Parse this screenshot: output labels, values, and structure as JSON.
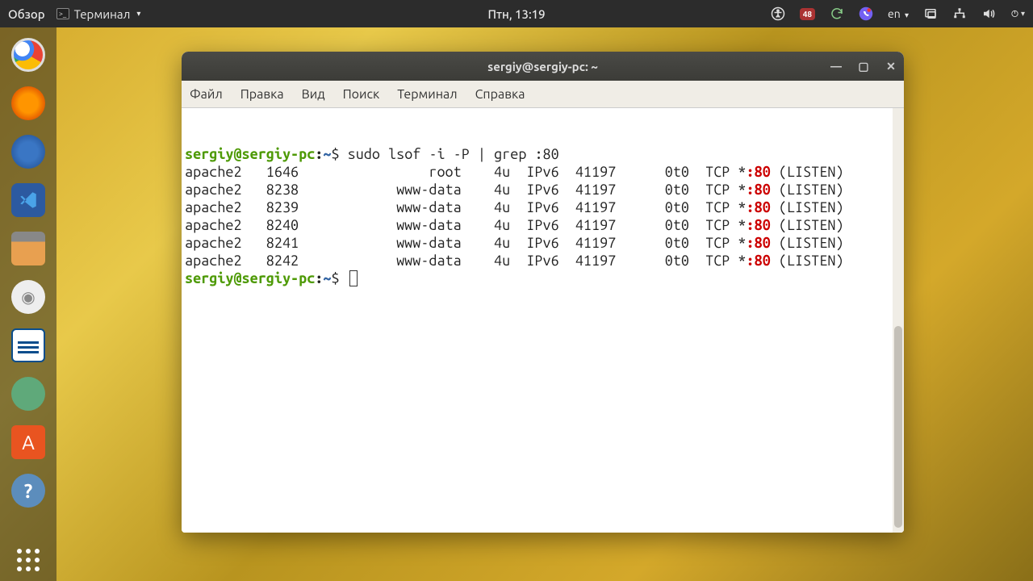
{
  "top_panel": {
    "overview": "Обзор",
    "app_menu": "Терминал",
    "clock": "Птн, 13:19",
    "tray": {
      "badge": "48",
      "lang": "en"
    }
  },
  "window": {
    "title": "sergiy@sergiy-pc: ~",
    "menu": {
      "file": "Файл",
      "edit": "Правка",
      "view": "Вид",
      "search": "Поиск",
      "terminal": "Терминал",
      "help": "Справка"
    }
  },
  "terminal": {
    "prompt_user": "sergiy@sergiy-pc",
    "prompt_path": "~",
    "command": "sudo lsof -i -P | grep :80",
    "rows": [
      {
        "proc": "apache2",
        "pid": "1646",
        "user": "root",
        "fd": "4u",
        "type": "IPv6",
        "dev": "41197",
        "sz": "0t0",
        "node": "TCP",
        "name_pre": "*",
        "port": ":80",
        "name_post": " (LISTEN)"
      },
      {
        "proc": "apache2",
        "pid": "8238",
        "user": "www-data",
        "fd": "4u",
        "type": "IPv6",
        "dev": "41197",
        "sz": "0t0",
        "node": "TCP",
        "name_pre": "*",
        "port": ":80",
        "name_post": " (LISTEN)"
      },
      {
        "proc": "apache2",
        "pid": "8239",
        "user": "www-data",
        "fd": "4u",
        "type": "IPv6",
        "dev": "41197",
        "sz": "0t0",
        "node": "TCP",
        "name_pre": "*",
        "port": ":80",
        "name_post": " (LISTEN)"
      },
      {
        "proc": "apache2",
        "pid": "8240",
        "user": "www-data",
        "fd": "4u",
        "type": "IPv6",
        "dev": "41197",
        "sz": "0t0",
        "node": "TCP",
        "name_pre": "*",
        "port": ":80",
        "name_post": " (LISTEN)"
      },
      {
        "proc": "apache2",
        "pid": "8241",
        "user": "www-data",
        "fd": "4u",
        "type": "IPv6",
        "dev": "41197",
        "sz": "0t0",
        "node": "TCP",
        "name_pre": "*",
        "port": ":80",
        "name_post": " (LISTEN)"
      },
      {
        "proc": "apache2",
        "pid": "8242",
        "user": "www-data",
        "fd": "4u",
        "type": "IPv6",
        "dev": "41197",
        "sz": "0t0",
        "node": "TCP",
        "name_pre": "*",
        "port": ":80",
        "name_post": " (LISTEN)"
      }
    ]
  }
}
